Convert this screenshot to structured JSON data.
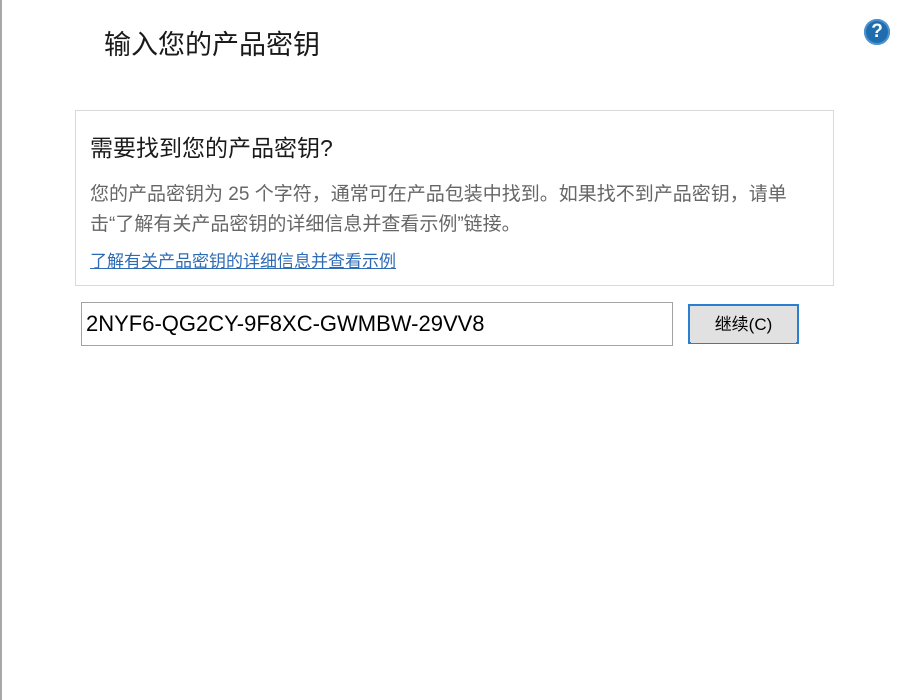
{
  "header": {
    "title": "输入您的产品密钥",
    "help_icon": "question-circle-icon",
    "help_glyph": "?"
  },
  "info_panel": {
    "heading": "需要找到您的产品密钥?",
    "description": "您的产品密钥为 25 个字符，通常可在产品包装中找到。如果找不到产品密钥，请单击“了解有关产品密钥的详细信息并查看示例”链接。",
    "link_text": "了解有关产品密钥的详细信息并查看示例"
  },
  "product_key": {
    "value": "2NYF6-QG2CY-9F8XC-GWMBW-29VV8"
  },
  "continue_button": {
    "label": "继续(C)"
  },
  "colors": {
    "help_icon": "#1f6cae",
    "link": "#2e6bb5",
    "button_focus_border": "#2b7fd0",
    "button_bg": "#e1e1e1"
  }
}
